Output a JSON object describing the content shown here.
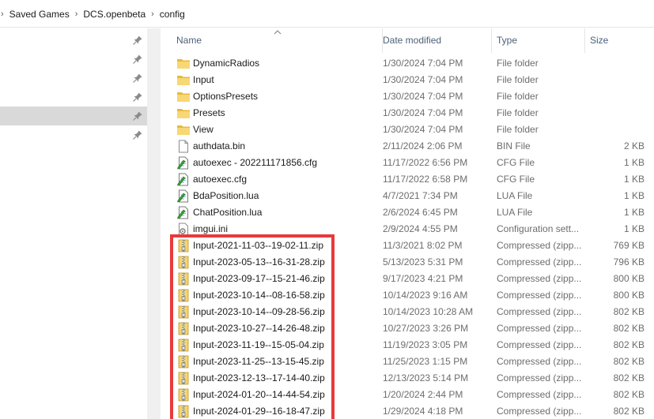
{
  "breadcrumb": {
    "segments": [
      "Saved Games",
      "DCS.openbeta",
      "config"
    ]
  },
  "nav": {
    "pinned_rows": 6,
    "selected_index": 4
  },
  "columns": {
    "name": "Name",
    "date": "Date modified",
    "type": "Type",
    "size": "Size"
  },
  "files": [
    {
      "name": "DynamicRadios",
      "date": "1/30/2024 7:04 PM",
      "type": "File folder",
      "size": "",
      "icon": "folder-icon"
    },
    {
      "name": "Input",
      "date": "1/30/2024 7:04 PM",
      "type": "File folder",
      "size": "",
      "icon": "folder-icon"
    },
    {
      "name": "OptionsPresets",
      "date": "1/30/2024 7:04 PM",
      "type": "File folder",
      "size": "",
      "icon": "folder-icon"
    },
    {
      "name": "Presets",
      "date": "1/30/2024 7:04 PM",
      "type": "File folder",
      "size": "",
      "icon": "folder-icon"
    },
    {
      "name": "View",
      "date": "1/30/2024 7:04 PM",
      "type": "File folder",
      "size": "",
      "icon": "folder-icon"
    },
    {
      "name": "authdata.bin",
      "date": "2/11/2024 2:06 PM",
      "type": "BIN File",
      "size": "2 KB",
      "icon": "file-icon"
    },
    {
      "name": "autoexec - 202211171856.cfg",
      "date": "11/17/2022 6:56 PM",
      "type": "CFG File",
      "size": "1 KB",
      "icon": "edit-file-icon"
    },
    {
      "name": "autoexec.cfg",
      "date": "11/17/2022 6:58 PM",
      "type": "CFG File",
      "size": "1 KB",
      "icon": "edit-file-icon"
    },
    {
      "name": "BdaPosition.lua",
      "date": "4/7/2021 7:34 PM",
      "type": "LUA File",
      "size": "1 KB",
      "icon": "edit-file-icon"
    },
    {
      "name": "ChatPosition.lua",
      "date": "2/6/2024 6:45 PM",
      "type": "LUA File",
      "size": "1 KB",
      "icon": "edit-file-icon"
    },
    {
      "name": "imgui.ini",
      "date": "2/9/2024 4:55 PM",
      "type": "Configuration sett...",
      "size": "1 KB",
      "icon": "settings-file-icon"
    },
    {
      "name": "Input-2021-11-03--19-02-11.zip",
      "date": "11/3/2021 8:02 PM",
      "type": "Compressed (zipp...",
      "size": "769 KB",
      "icon": "zip-icon"
    },
    {
      "name": "Input-2023-05-13--16-31-28.zip",
      "date": "5/13/2023 5:31 PM",
      "type": "Compressed (zipp...",
      "size": "796 KB",
      "icon": "zip-icon"
    },
    {
      "name": "Input-2023-09-17--15-21-46.zip",
      "date": "9/17/2023 4:21 PM",
      "type": "Compressed (zipp...",
      "size": "800 KB",
      "icon": "zip-icon"
    },
    {
      "name": "Input-2023-10-14--08-16-58.zip",
      "date": "10/14/2023 9:16 AM",
      "type": "Compressed (zipp...",
      "size": "800 KB",
      "icon": "zip-icon"
    },
    {
      "name": "Input-2023-10-14--09-28-56.zip",
      "date": "10/14/2023 10:28 AM",
      "type": "Compressed (zipp...",
      "size": "802 KB",
      "icon": "zip-icon"
    },
    {
      "name": "Input-2023-10-27--14-26-48.zip",
      "date": "10/27/2023 3:26 PM",
      "type": "Compressed (zipp...",
      "size": "802 KB",
      "icon": "zip-icon"
    },
    {
      "name": "Input-2023-11-19--15-05-04.zip",
      "date": "11/19/2023 3:05 PM",
      "type": "Compressed (zipp...",
      "size": "802 KB",
      "icon": "zip-icon"
    },
    {
      "name": "Input-2023-11-25--13-15-45.zip",
      "date": "11/25/2023 1:15 PM",
      "type": "Compressed (zipp...",
      "size": "802 KB",
      "icon": "zip-icon"
    },
    {
      "name": "Input-2023-12-13--17-14-40.zip",
      "date": "12/13/2023 5:14 PM",
      "type": "Compressed (zipp...",
      "size": "802 KB",
      "icon": "zip-icon"
    },
    {
      "name": "Input-2024-01-20--14-44-54.zip",
      "date": "1/20/2024 2:44 PM",
      "type": "Compressed (zipp...",
      "size": "802 KB",
      "icon": "zip-icon"
    },
    {
      "name": "Input-2024-01-29--16-18-47.zip",
      "date": "1/29/2024 4:18 PM",
      "type": "Compressed (zipp...",
      "size": "802 KB",
      "icon": "zip-icon"
    }
  ],
  "colors": {
    "highlight_border": "#e83a3a",
    "folder_yellow": "#f8d775",
    "nav_selected": "#d9d9d9",
    "header_text": "#4c607a"
  }
}
